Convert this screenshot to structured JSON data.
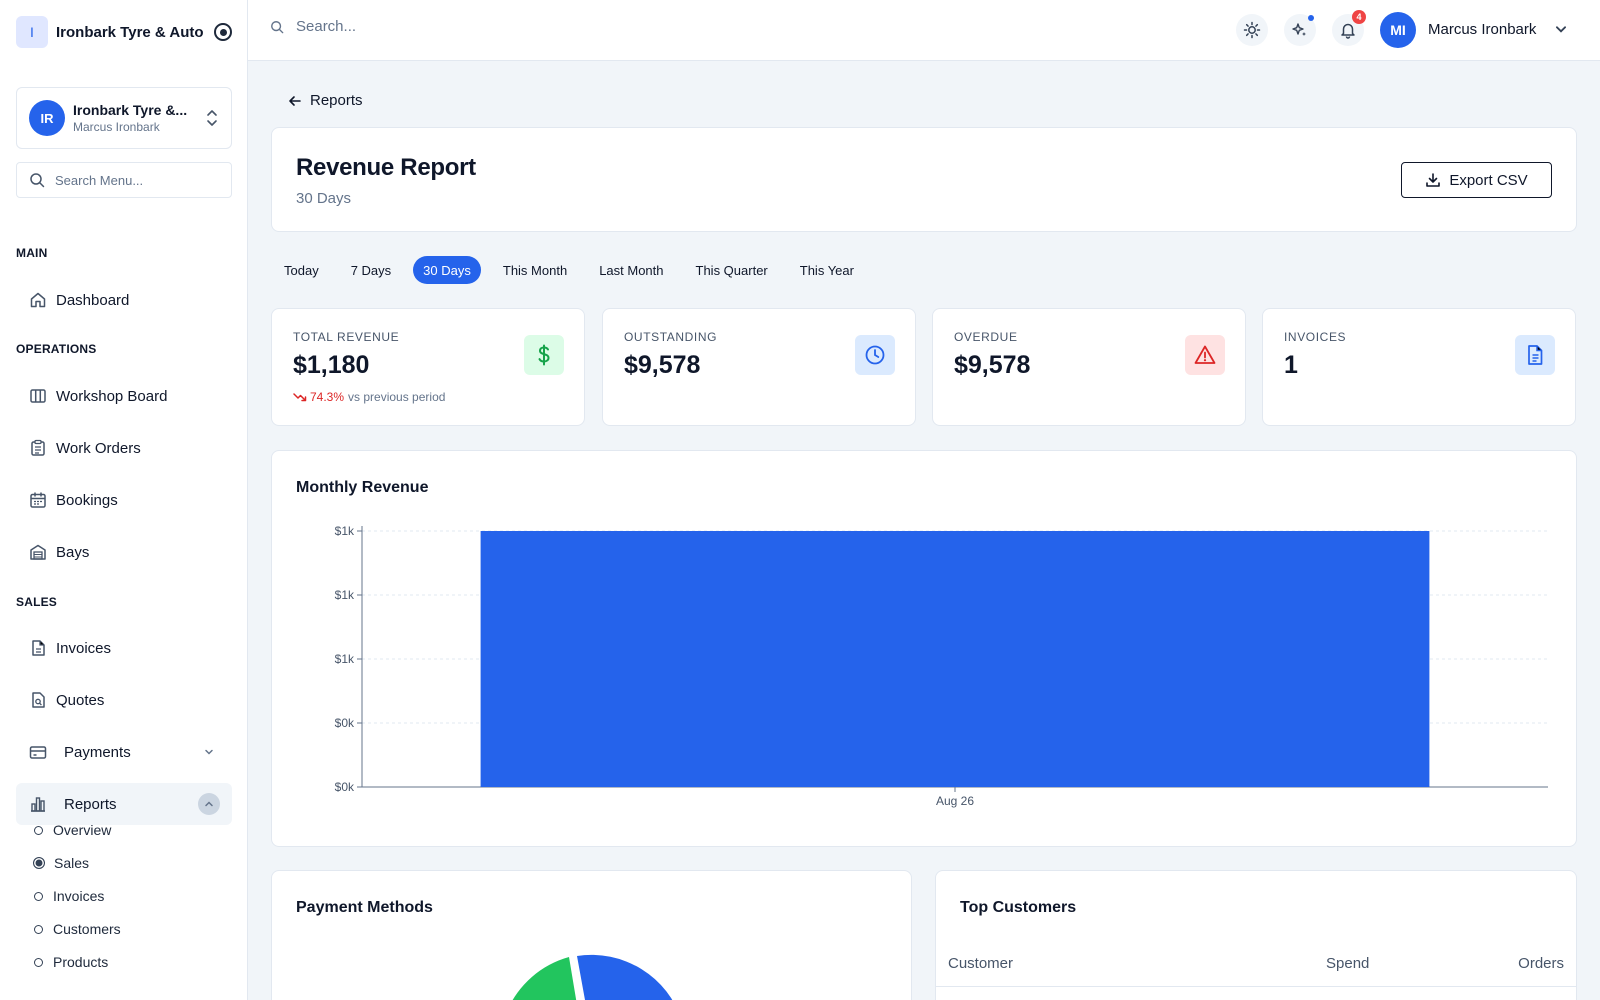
{
  "brand": {
    "logo_letter": "I",
    "name": "Ironbark Tyre & Auto"
  },
  "org": {
    "initials": "IR",
    "name": "Ironbark Tyre &...",
    "user": "Marcus Ironbark"
  },
  "menu_search": {
    "placeholder": "Search Menu..."
  },
  "sections": {
    "main": "MAIN",
    "operations": "OPERATIONS",
    "sales": "SALES"
  },
  "nav": {
    "dashboard": "Dashboard",
    "workshop_board": "Workshop Board",
    "work_orders": "Work Orders",
    "bookings": "Bookings",
    "bays": "Bays",
    "invoices": "Invoices",
    "quotes": "Quotes",
    "payments": "Payments",
    "reports": "Reports"
  },
  "reports_sub": [
    "Overview",
    "Sales",
    "Invoices",
    "Customers",
    "Products"
  ],
  "reports_sub_selected": "Sales",
  "topbar": {
    "search_placeholder": "Search...",
    "notification_count": "4",
    "user_initials": "MI",
    "user_name": "Marcus Ironbark"
  },
  "back": {
    "label": "Reports"
  },
  "header": {
    "title": "Revenue Report",
    "subtitle": "30 Days",
    "export_label": "Export CSV"
  },
  "ranges": [
    "Today",
    "7 Days",
    "30 Days",
    "This Month",
    "Last Month",
    "This Quarter",
    "This Year"
  ],
  "range_selected": "30 Days",
  "kpis": {
    "total_revenue": {
      "label": "TOTAL REVENUE",
      "value": "$1,180",
      "trend_pct": "74.3%",
      "trend_text": "vs previous period",
      "color": "#16a34a",
      "bg": "#dcfce7",
      "icon": "dollar-icon"
    },
    "outstanding": {
      "label": "OUTSTANDING",
      "value": "$9,578",
      "color": "#2563eb",
      "bg": "#dbeafe",
      "icon": "clock-icon"
    },
    "overdue": {
      "label": "OVERDUE",
      "value": "$9,578",
      "color": "#dc2626",
      "bg": "#fee2e2",
      "icon": "warning-icon"
    },
    "invoices": {
      "label": "INVOICES",
      "value": "1",
      "color": "#2563eb",
      "bg": "#dbeafe",
      "icon": "document-icon"
    }
  },
  "chart_data": {
    "type": "bar",
    "title": "Monthly Revenue",
    "categories": [
      "Aug 26"
    ],
    "values": [
      1180
    ],
    "ylim": [
      0,
      1180
    ],
    "yticks": [
      0,
      295,
      590,
      885,
      1180
    ],
    "ytick_labels": [
      "$0k",
      "$0k",
      "$1k",
      "$1k",
      "$1k"
    ],
    "color": "#2563eb",
    "grid": true,
    "xlabel": "",
    "ylabel": ""
  },
  "payment_methods": {
    "title": "Payment Methods",
    "colors": [
      "#2563eb",
      "#22c55e"
    ]
  },
  "top_customers": {
    "title": "Top Customers",
    "columns": [
      "Customer",
      "Spend",
      "Orders"
    ]
  }
}
